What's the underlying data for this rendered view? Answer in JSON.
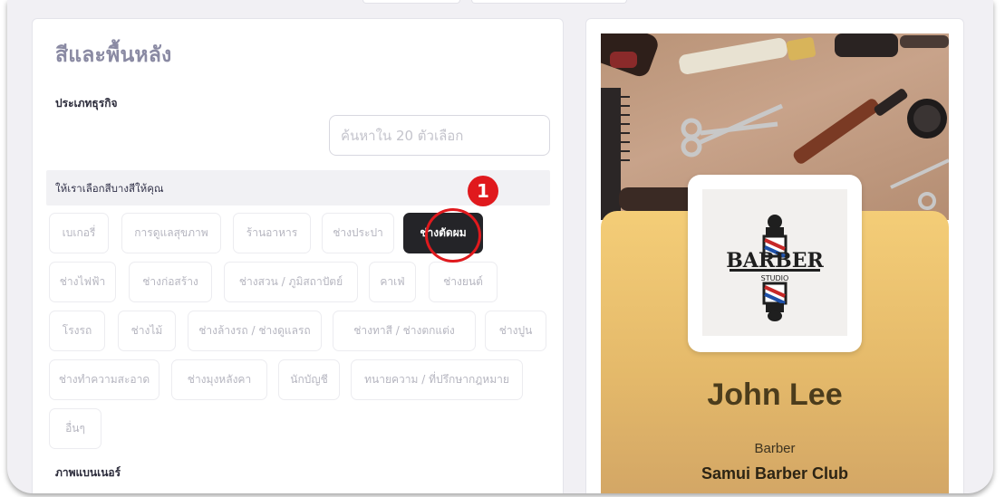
{
  "left_panel": {
    "section_title": "สีและพื้นหลัง",
    "business_type_label": "ประเภทธุรกิจ",
    "search_placeholder": "ค้นหาใน 20 ตัวเลือก",
    "suggest_label": "ให้เราเลือกสีบางสีให้คุณ",
    "chips": [
      {
        "label": "เบเกอรี่",
        "active": false
      },
      {
        "label": "การดูแลสุขภาพ",
        "active": false
      },
      {
        "label": "ร้านอาหาร",
        "active": false
      },
      {
        "label": "ช่างประปา",
        "active": false
      },
      {
        "label": "ช่างตัดผม",
        "active": true
      },
      {
        "label": "ช่างไฟฟ้า",
        "active": false
      },
      {
        "label": "ช่างก่อสร้าง",
        "active": false
      },
      {
        "label": "ช่างสวน / ภูมิสถาปัตย์",
        "active": false
      },
      {
        "label": "คาเฟ่",
        "active": false
      },
      {
        "label": "ช่างยนต์",
        "active": false
      },
      {
        "label": "โรงรถ",
        "active": false
      },
      {
        "label": "ช่างไม้",
        "active": false
      },
      {
        "label": "ช่างล้างรถ / ช่างดูแลรถ",
        "active": false
      },
      {
        "label": "ช่างทาสี / ช่างตกแต่ง",
        "active": false
      },
      {
        "label": "ช่างปูน",
        "active": false
      },
      {
        "label": "ช่างทำความสะอาด",
        "active": false
      },
      {
        "label": "ช่างมุงหลังคา",
        "active": false
      },
      {
        "label": "นักบัญชี",
        "active": false
      },
      {
        "label": "ทนายความ / ที่ปรึกษากฎหมาย",
        "active": false
      },
      {
        "label": "อื่นๆ",
        "active": false
      }
    ],
    "banner_label": "ภาพแบนเนอร์"
  },
  "annotation": {
    "step_number": "1",
    "color": "#e0191d"
  },
  "preview": {
    "logo_text": "BARBER",
    "logo_subtext": "STUDIO",
    "name": "John Lee",
    "role": "Barber",
    "company": "Samui Barber Club",
    "accent_color": "#f4cd77"
  }
}
